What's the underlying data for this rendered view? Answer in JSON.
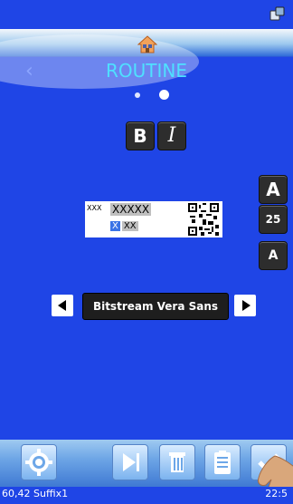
{
  "header": {
    "title": "ROUTINE"
  },
  "toolbar": {
    "bold_label": "B",
    "italic_label": "I"
  },
  "size_controls": {
    "increase_label": "A",
    "value": "25",
    "decrease_label": "A"
  },
  "preview": {
    "small_text": "XXX",
    "big_text": "XXXXX",
    "suffix_x": "X",
    "suffix_xx": "XX"
  },
  "font": {
    "name": "Bitstream Vera Sans"
  },
  "status": {
    "left": "60,42 Suffix1",
    "right": "22:5"
  },
  "pager": {
    "pages": 2,
    "current": 2
  },
  "colors": {
    "background": "#1f45e6",
    "title": "#4fe0ff",
    "button_dark": "#2d2d2d"
  }
}
